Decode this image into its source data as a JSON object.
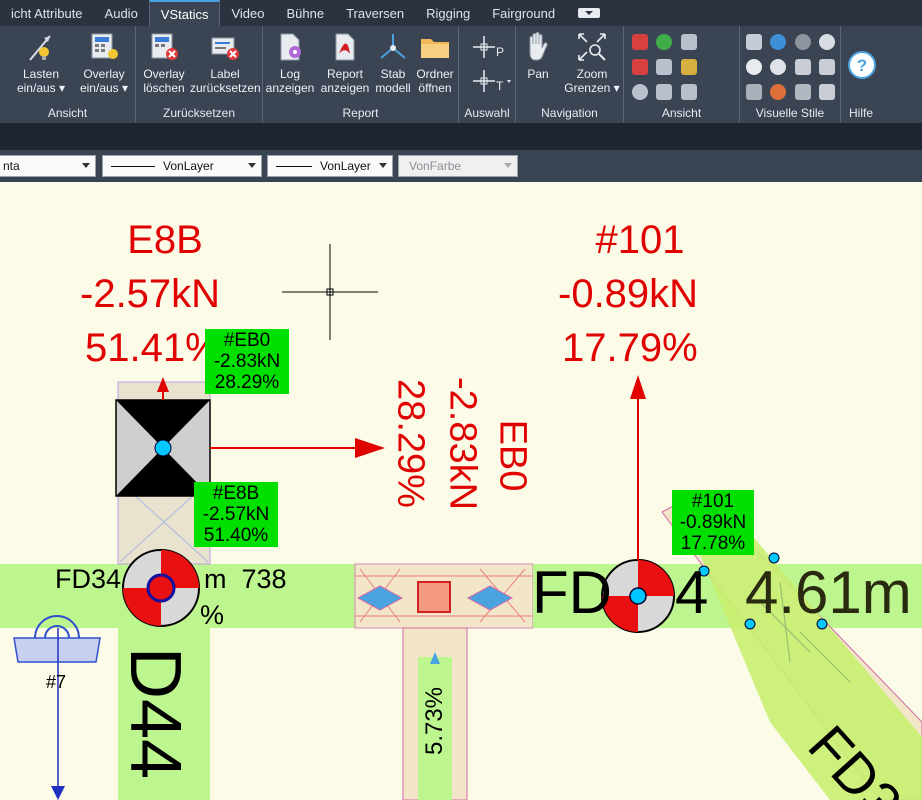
{
  "tabs": [
    "icht Attribute",
    "Audio",
    "VStatics",
    "Video",
    "Bühne",
    "Traversen",
    "Rigging",
    "Fairground"
  ],
  "active_tab": "VStatics",
  "ribbon": {
    "panels": [
      {
        "label": "Ansicht",
        "buttons": [
          {
            "l1": "Lasten",
            "l2": "ein/aus"
          },
          {
            "l1": "Overlay",
            "l2": "ein/aus"
          }
        ]
      },
      {
        "label": "Zurücksetzen",
        "buttons": [
          {
            "l1": "Overlay",
            "l2": "löschen"
          },
          {
            "l1": "Label",
            "l2": "zurücksetzen"
          }
        ]
      },
      {
        "label": "Report",
        "buttons": [
          {
            "l1": "Log",
            "l2": "anzeigen"
          },
          {
            "l1": "Report",
            "l2": "anzeigen"
          },
          {
            "l1": "Stab",
            "l2": "modell"
          },
          {
            "l1": "Ordner",
            "l2": "öffnen"
          }
        ]
      },
      {
        "label": "Auswahl"
      },
      {
        "label": "Navigation",
        "buttons": [
          {
            "l1": "Pan",
            "l2": ""
          },
          {
            "l1": "Zoom",
            "l2": "Grenzen"
          }
        ]
      },
      {
        "label": "Ansicht"
      },
      {
        "label": "Visuelle Stile"
      },
      {
        "label": "Hilfe"
      }
    ]
  },
  "properties": {
    "color": "nta",
    "linetype": "VonLayer",
    "lineweight": "VonLayer",
    "plotstyle": "VonFarbe"
  },
  "drawing": {
    "left_load": {
      "name": "E8B",
      "force": "-2.57kN",
      "percent": "51.41%"
    },
    "right_load": {
      "name": "#101",
      "force": "-0.89kN",
      "percent": "17.79%"
    },
    "rot_label": {
      "name": "EB0",
      "force": "-2.83kN",
      "percent": "28.29%"
    },
    "green_eb0": {
      "name": "#EB0",
      "force": "-2.83kN",
      "percent": "28.29%"
    },
    "green_e8b": {
      "name": "#E8B",
      "force": "-2.57kN",
      "percent": "51.40%"
    },
    "green_101": {
      "name": "#101",
      "force": "-0.89kN",
      "percent": "17.78%"
    },
    "truss_text_left": "FD34",
    "truss_text_left2": "m  738",
    "truss_text_pct": "%",
    "truss_text_mid": "FD",
    "truss_text_mid2": "4",
    "truss_text_right": "4.61m",
    "vert_left": "D44",
    "vert_mid_pct": "5.73%",
    "diag_right": "FD3",
    "node_label": "#7"
  }
}
